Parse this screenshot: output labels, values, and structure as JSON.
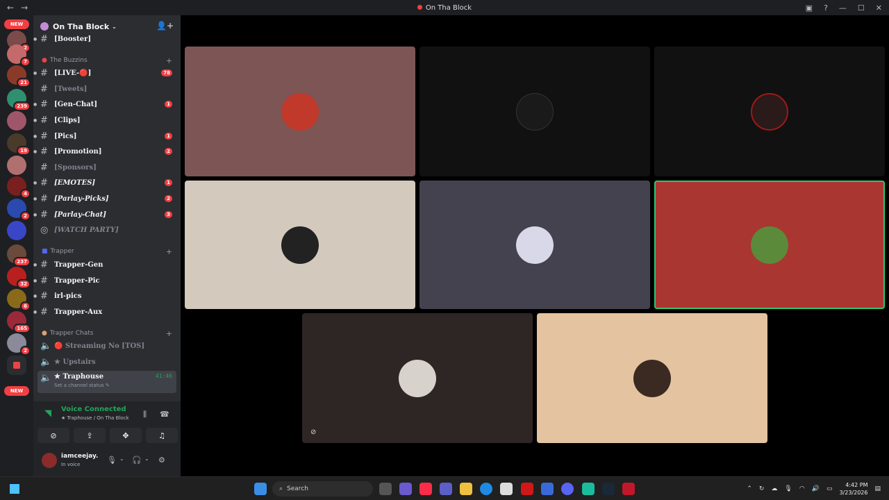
{
  "window": {
    "title": "On Tha Block"
  },
  "rail": {
    "new_top": "NEW",
    "new_bottom": "NEW",
    "servers": [
      {
        "badge": "2"
      },
      {
        "badge": "7"
      },
      {
        "badge": "21"
      },
      {
        "badge": "239"
      },
      {
        "badge": ""
      },
      {
        "badge": "19"
      },
      {
        "badge": ""
      },
      {
        "badge": "4"
      },
      {
        "badge": "2"
      },
      {
        "badge": ""
      },
      {
        "badge": "237"
      },
      {
        "badge": "32"
      },
      {
        "badge": "6"
      },
      {
        "badge": "165"
      },
      {
        "badge": "2"
      },
      {
        "badge": ""
      }
    ]
  },
  "guild": {
    "name": "On Tha Block"
  },
  "categories": {
    "buzzins": "The Buzzins",
    "trapper": "Trapper",
    "trapper_chats": "Trapper Chats"
  },
  "channels": {
    "booster": "[Booster]",
    "live": "[LIVE-🔴]",
    "live_badge": "78",
    "tweets": "[Tweets]",
    "genchat": "[Gen-Chat]",
    "genchat_badge": "1",
    "clips": "[Clips]",
    "pics": "[Pics]",
    "pics_badge": "1",
    "promotion": "[Promotion]",
    "promotion_badge": "2",
    "sponsors": "[Sponsors]",
    "emotes": "[EMOTES]",
    "emotes_badge": "1",
    "parlay_picks": "[Parlay-Picks]",
    "parlay_picks_badge": "2",
    "parlay_chat": "[Parlay-Chat]",
    "parlay_chat_badge": "3",
    "watch_party": "[WATCH PARTY]",
    "trapper_gen": "Trapper-Gen",
    "trapper_pic": "Trapper-Pic",
    "irl_pics": "irl-pics",
    "trapper_aux": "Trapper-Aux",
    "streaming_no": "🔴 Streaming No [TOS]",
    "upstairs": "★ Upstairs",
    "traphouse": "★ Traphouse",
    "traphouse_time": "41:46",
    "traphouse_status": "Set a channel status ✎"
  },
  "voice": {
    "connected": "Voice Connected",
    "location": "★ Traphouse / On Tha Block"
  },
  "user": {
    "name": "iamceejay.",
    "status": "In voice"
  },
  "stage": {
    "tiles": [
      {
        "color": "#7d5555"
      },
      {
        "color": "#111111"
      },
      {
        "color": "#111111"
      },
      {
        "color": "#d3c9bd"
      },
      {
        "color": "#454250"
      },
      {
        "color": "#a93631"
      },
      {
        "color": "#2e2625"
      },
      {
        "color": "#e4c3a0"
      }
    ]
  },
  "taskbar": {
    "search_placeholder": "Search",
    "time": "4:42 PM",
    "date": "3/23/2026"
  }
}
